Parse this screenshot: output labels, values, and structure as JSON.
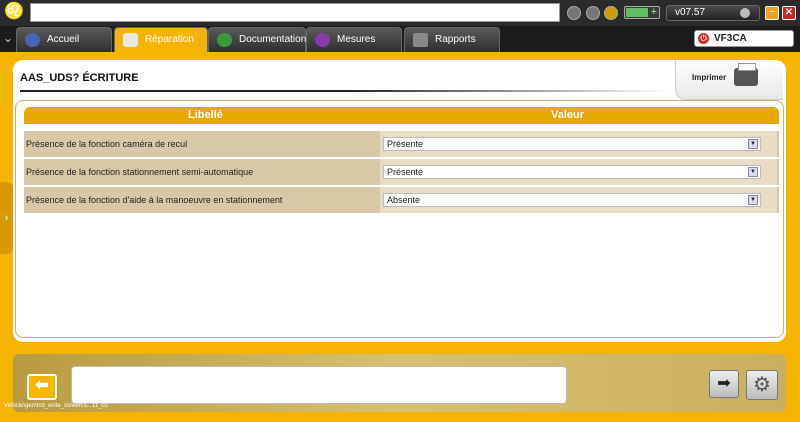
{
  "topbar": {
    "logo_icon": "lion-logo-icon",
    "address_value": "",
    "version": "v07.57",
    "minimize_glyph": "–",
    "close_glyph": "✕"
  },
  "tabs": [
    {
      "label": "Accueil",
      "icon": "home-icon"
    },
    {
      "label": "Réparation",
      "icon": "magnifier-icon"
    },
    {
      "label": "Documentation",
      "icon": "book-icon"
    },
    {
      "label": "Mesures",
      "icon": "oscilloscope-icon"
    },
    {
      "label": "Rapports",
      "icon": "report-icon"
    }
  ],
  "vehicle": {
    "code": "VF3CA"
  },
  "page": {
    "title": "AAS_UDS?  ÉCRITURE",
    "print_label": "Imprimer"
  },
  "table": {
    "headers": {
      "label": "Libellé",
      "value": "Valeur"
    },
    "rows": [
      {
        "label": "Présence de la fonction caméra de recul",
        "value": "Présente"
      },
      {
        "label": "Présence de la fonction stationnement semi-automatique",
        "value": "Présente"
      },
      {
        "label": "Présence de la fonction d'aide à la manoeuvre en stationnement",
        "value": "Absente"
      }
    ]
  },
  "footer": {
    "message": "",
    "screen_id": "Vehicle\\gen\\tcd_write_screen.s...11_02"
  },
  "colors": {
    "accent": "#f5b400",
    "header": "#e8a800",
    "row_bg": "#d8c8a8"
  }
}
